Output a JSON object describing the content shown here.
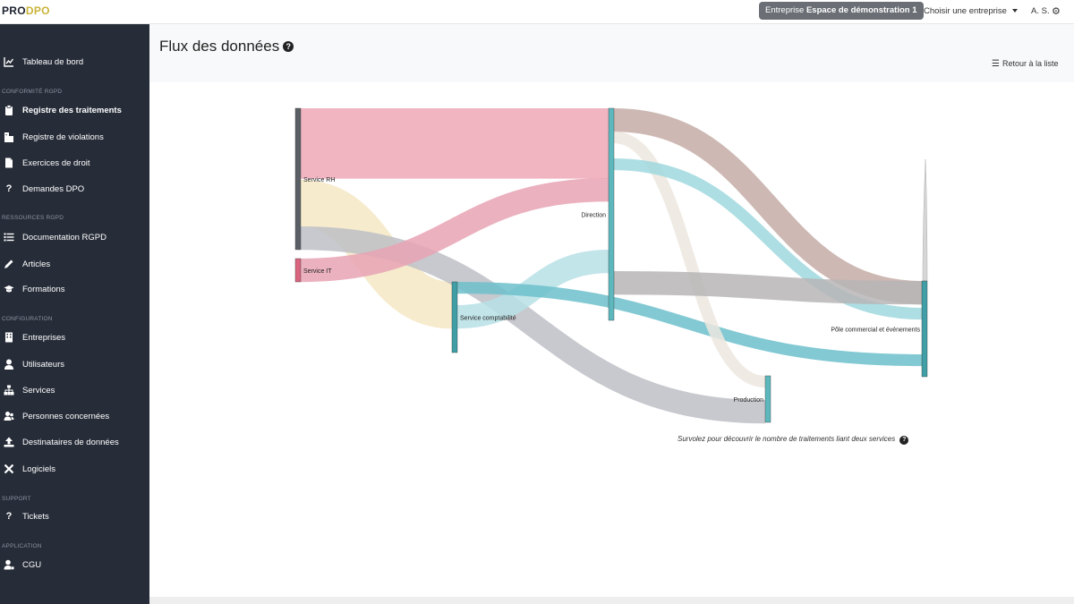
{
  "topbar": {
    "logo_pro": "PRO",
    "logo_dpo": "DPO",
    "company_prefix": "Entreprise",
    "company_name": "Espace de démonstration 1",
    "choose_company": "Choisir une entreprise",
    "user_initials": "A. S."
  },
  "sidebar": {
    "items": [
      {
        "label": "Tableau de bord",
        "icon": "chart-line-icon"
      },
      {
        "label": "Registre des traitements",
        "icon": "clipboard-icon"
      },
      {
        "label": "Registre de violations",
        "icon": "building-icon"
      },
      {
        "label": "Exercices de droit",
        "icon": "file-icon"
      },
      {
        "label": "Demandes DPO",
        "icon": "question-icon"
      },
      {
        "label": "Documentation RGPD",
        "icon": "list-icon"
      },
      {
        "label": "Articles",
        "icon": "pencil-icon"
      },
      {
        "label": "Formations",
        "icon": "graduation-cap-icon"
      },
      {
        "label": "Entreprises",
        "icon": "building-icon"
      },
      {
        "label": "Utilisateurs",
        "icon": "user-icon"
      },
      {
        "label": "Services",
        "icon": "sitemap-icon"
      },
      {
        "label": "Personnes concernées",
        "icon": "users-icon"
      },
      {
        "label": "Destinataires de données",
        "icon": "upload-icon"
      },
      {
        "label": "Logiciels",
        "icon": "tools-icon"
      },
      {
        "label": "Tickets",
        "icon": "question-icon"
      },
      {
        "label": "CGU",
        "icon": "user-lock-icon"
      }
    ],
    "sections": [
      "Conformité RGPD",
      "Ressources RGPD",
      "Configuration",
      "Support",
      "Application"
    ]
  },
  "main": {
    "title": "Flux des données",
    "back_link": "Retour à la liste",
    "hint": "Survolez pour découvrir le nombre de traitements liant deux services"
  },
  "chart_data": {
    "type": "sankey",
    "nodes": [
      {
        "name": "Service RH",
        "color": "#5a5f66"
      },
      {
        "name": "Service IT",
        "color": "#d9657f"
      },
      {
        "name": "Service comptabilité",
        "color": "#3f9ea6"
      },
      {
        "name": "Direction",
        "color": "#5cb8bc"
      },
      {
        "name": "Production",
        "color": "#5cb8bc"
      },
      {
        "name": "Pôle commercial et événements",
        "color": "#3f9ea6"
      }
    ],
    "links": [
      {
        "source": "Service RH",
        "target": "Direction",
        "value": 6,
        "color": "#eea8b6"
      },
      {
        "source": "Service RH",
        "target": "Service comptabilité",
        "value": 4,
        "color": "#f4e8c4"
      },
      {
        "source": "Service RH",
        "target": "Production",
        "value": 2,
        "color": "#bdbfc6"
      },
      {
        "source": "Service IT",
        "target": "Direction",
        "value": 2,
        "color": "#e8a3b4"
      },
      {
        "source": "Service comptabilité",
        "target": "Direction",
        "value": 2,
        "color": "#b7e0e6"
      },
      {
        "source": "Service comptabilité",
        "target": "Pôle commercial et événements",
        "value": 1,
        "color": "#6cc0cb"
      },
      {
        "source": "Direction",
        "target": "Pôle commercial et événements",
        "value": 2,
        "color": "#c4aca6"
      },
      {
        "source": "Direction",
        "target": "Production",
        "value": 1,
        "color": "#ece6de"
      },
      {
        "source": "Direction",
        "target": "Pôle commercial et événements",
        "value": 1,
        "color": "#9fd8de"
      },
      {
        "source": "Pôle commercial et événements",
        "target": "Direction",
        "value": 2,
        "color": "#b7b5b6"
      }
    ]
  }
}
